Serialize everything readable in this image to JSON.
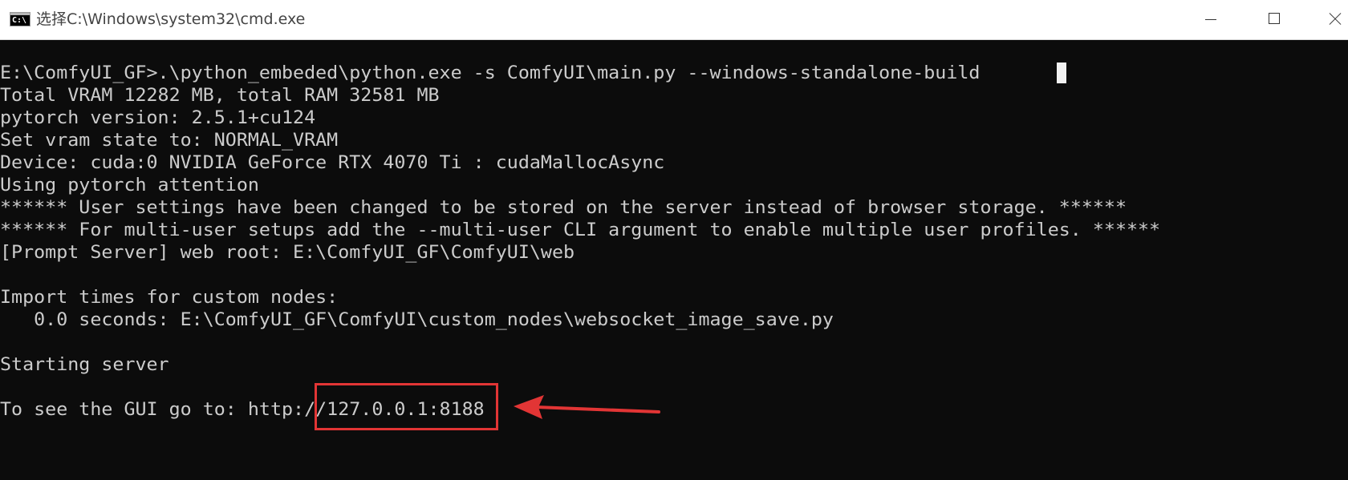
{
  "window": {
    "title": "选择C:\\Windows\\system32\\cmd.exe",
    "icon": "cmd-icon",
    "icon_text": "C:\\",
    "controls": [
      "minimize",
      "maximize",
      "close"
    ]
  },
  "console": {
    "lines": [
      "E:\\ComfyUI_GF>.\\python_embeded\\python.exe -s ComfyUI\\main.py --windows-standalone-build",
      "Total VRAM 12282 MB, total RAM 32581 MB",
      "pytorch version: 2.5.1+cu124",
      "Set vram state to: NORMAL_VRAM",
      "Device: cuda:0 NVIDIA GeForce RTX 4070 Ti : cudaMallocAsync",
      "Using pytorch attention",
      "****** User settings have been changed to be stored on the server instead of browser storage. ******",
      "****** For multi-user setups add the --multi-user CLI argument to enable multiple user profiles. ******",
      "[Prompt Server] web root: E:\\ComfyUI_GF\\ComfyUI\\web",
      "",
      "Import times for custom nodes:",
      "   0.0 seconds: E:\\ComfyUI_GF\\ComfyUI\\custom_nodes\\websocket_image_save.py",
      "",
      "Starting server",
      "",
      "To see the GUI go to: http://127.0.0.1:8188"
    ]
  },
  "annotation": {
    "highlighted_text": "127.0.0.1:8188",
    "color": "#e23535"
  }
}
